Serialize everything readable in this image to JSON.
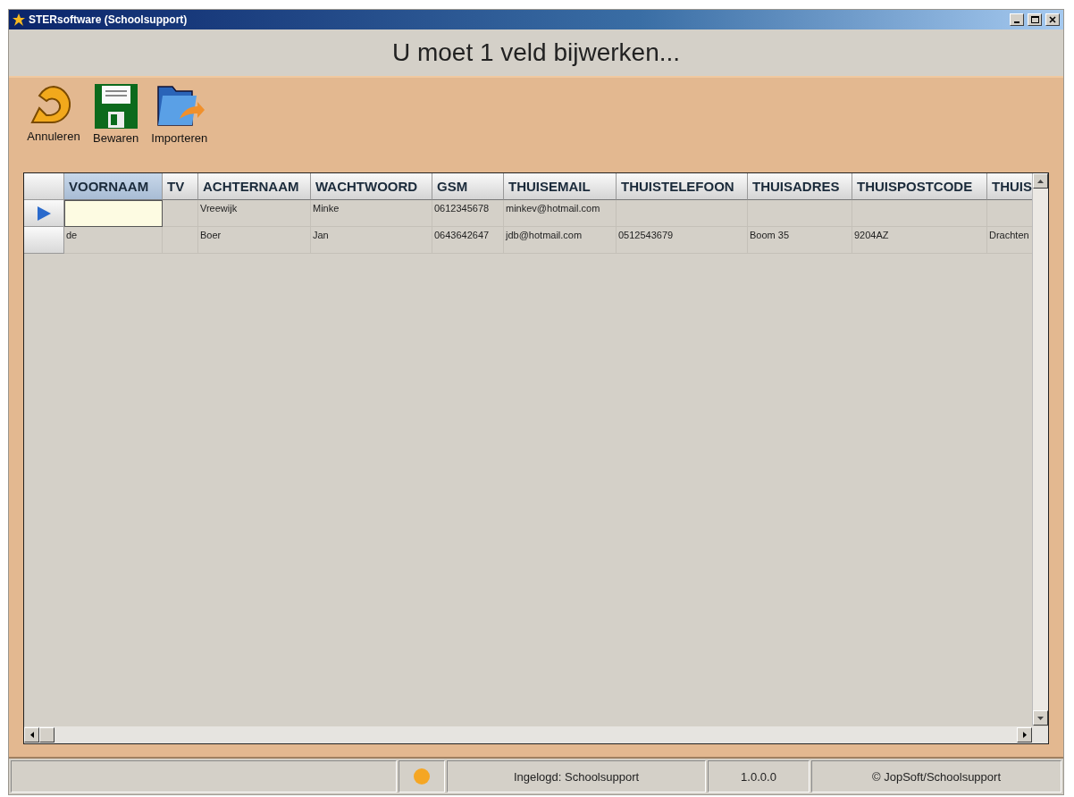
{
  "window": {
    "title": "STERsoftware (Schoolsupport)"
  },
  "header": "U moet 1 veld bijwerken...",
  "toolbar": [
    {
      "kind": "cancel",
      "label": "Annuleren"
    },
    {
      "kind": "save",
      "label": "Bewaren"
    },
    {
      "kind": "import",
      "label": "Importeren"
    }
  ],
  "table": {
    "columns": [
      {
        "label": "VOORNAAM",
        "selected": true
      },
      {
        "label": "TV",
        "selected": false
      },
      {
        "label": "ACHTERNAAM",
        "selected": false
      },
      {
        "label": "WACHTWOORD",
        "selected": false
      },
      {
        "label": "GSM",
        "selected": false
      },
      {
        "label": "THUISEMAIL",
        "selected": false
      },
      {
        "label": "THUISTELEFOON",
        "selected": false
      },
      {
        "label": "THUISADRES",
        "selected": false
      },
      {
        "label": "THUISPOSTCODE",
        "selected": false
      },
      {
        "label": "THUIS",
        "selected": false
      }
    ],
    "rows": [
      {
        "current": true,
        "cells": [
          "",
          "",
          "Vreewijk",
          "Minke",
          "0612345678",
          "minkev@hotmail.com",
          "",
          "",
          "",
          ""
        ]
      },
      {
        "current": false,
        "cells": [
          "de",
          "",
          "Boer",
          "Jan",
          "0643642647",
          "jdb@hotmail.com",
          "0512543679",
          "Boom 35",
          "9204AZ",
          "Drachten"
        ]
      }
    ]
  },
  "status_bar": {
    "login": "Ingelogd: Schoolsupport",
    "version": "1.0.0.0",
    "copyright": "© JopSoft/Schoolsupport"
  }
}
